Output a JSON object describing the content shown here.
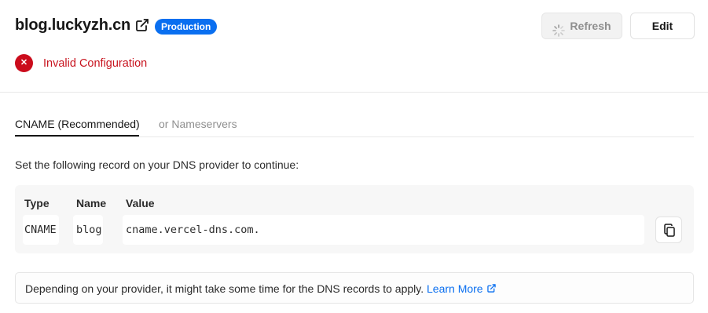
{
  "header": {
    "domain": "blog.luckyzh.cn",
    "badge": "Production",
    "refresh_label": "Refresh",
    "edit_label": "Edit"
  },
  "status": {
    "text": "Invalid Configuration",
    "icon": "x-circle-icon",
    "color": "#cb0c1c"
  },
  "tabs": [
    {
      "label": "CNAME (Recommended)",
      "active": true
    },
    {
      "label": "or Nameservers",
      "active": false
    }
  ],
  "instruction": "Set the following record on your DNS provider to continue:",
  "record": {
    "headers": [
      "Type",
      "Name",
      "Value"
    ],
    "row": [
      "CNAME",
      "blog",
      "cname.vercel-dns.com."
    ]
  },
  "note": {
    "text": "Depending on your provider, it might take some time for the DNS records to apply.",
    "link_label": "Learn More"
  },
  "colors": {
    "accent": "#0a6ff0",
    "error": "#cb0c1c"
  }
}
